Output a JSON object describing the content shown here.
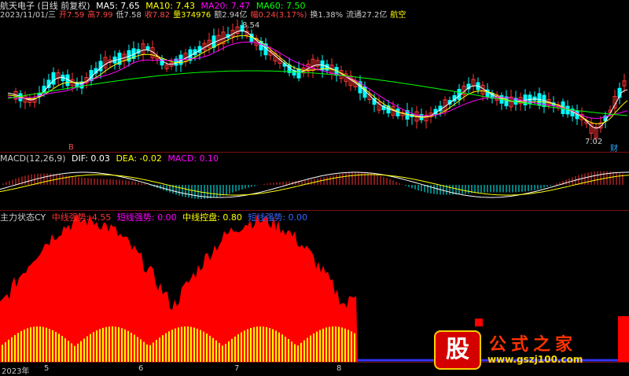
{
  "colors": {
    "up": "#ff3333",
    "down": "#00ffff",
    "ma5": "#ffffff",
    "ma10": "#ffff00",
    "ma20": "#ff00ff",
    "ma60": "#00ff00",
    "grid": "#7a1010",
    "red": "#ff0000",
    "yellow": "#ffff00",
    "blue": "#3333ff"
  },
  "header": {
    "title": "航天电子 (日线 前复权)",
    "ma5": "MA5: 7.65",
    "ma10": "MA10: 7.43",
    "ma20": "MA20: 7.47",
    "ma60": "MA60: 7.50",
    "info": [
      "2023/11/01/三",
      "开7.59",
      "高7.99",
      "低7.58",
      "收7.82",
      "量374976",
      "额2.94亿",
      "幅0.24(3.17%)",
      "换1.38%",
      "流通27.2亿",
      "航空"
    ]
  },
  "kline": {
    "high_label": "8.54",
    "low_label": "7.02",
    "marker": "B",
    "marker2": "财"
  },
  "macd": {
    "name": "MACD(12,26,9)",
    "dif": "DIF: 0.03",
    "dea": "DEA: -0.02",
    "macd": "MACD: 0.10"
  },
  "main": {
    "name": "主力状态CY",
    "l1": "中线强势: 4.55",
    "l2": "短线强势: 0.00",
    "l3": "中线控盘: 0.80",
    "l4": "短线强势: 0.00"
  },
  "xaxis": [
    "2023年",
    "5",
    "6",
    "7",
    "8"
  ],
  "watermark": {
    "glyph": "股",
    "text": "公式之家",
    "url": "www.gszj100.com"
  }
}
